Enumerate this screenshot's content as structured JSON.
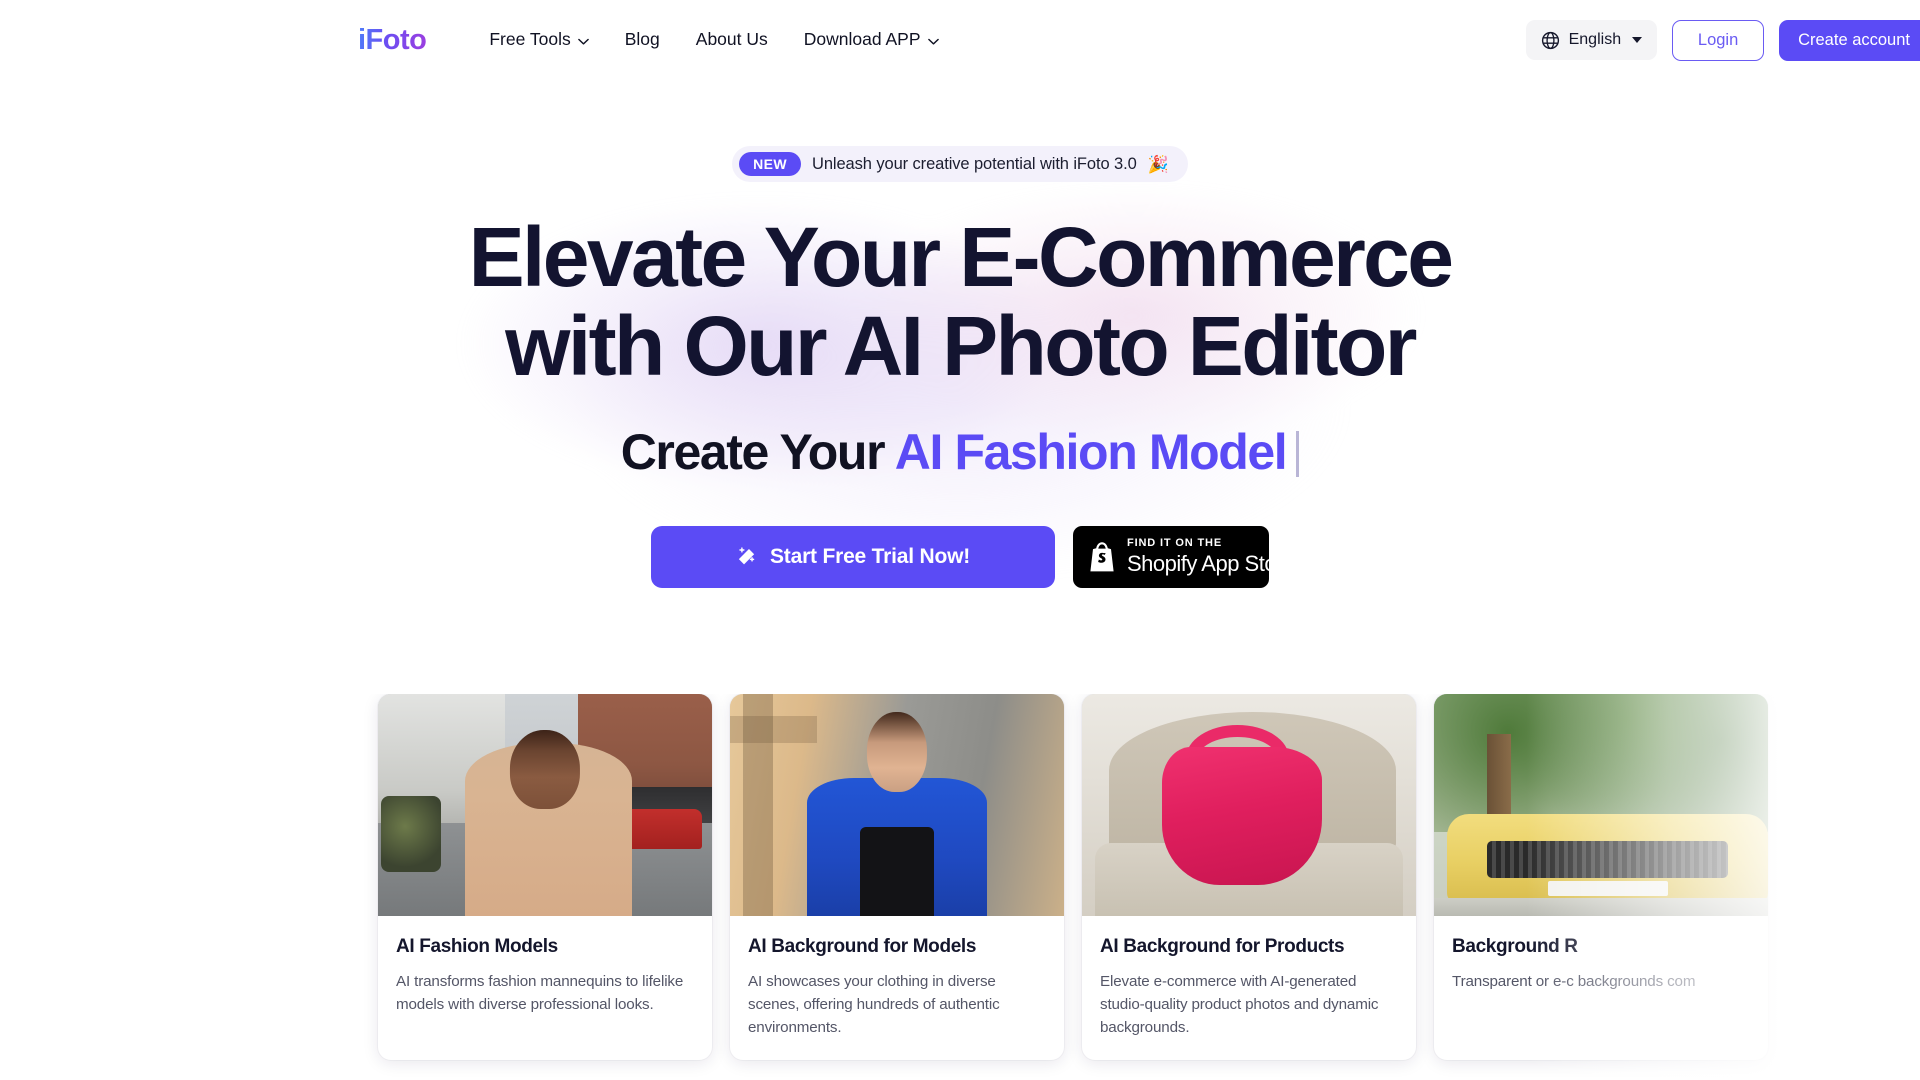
{
  "brand": {
    "name": "iFoto"
  },
  "nav": {
    "items": [
      {
        "label": "Free Tools",
        "has_dropdown": true
      },
      {
        "label": "Blog",
        "has_dropdown": false
      },
      {
        "label": "About Us",
        "has_dropdown": false
      },
      {
        "label": "Download APP",
        "has_dropdown": true
      }
    ]
  },
  "header_actions": {
    "language": {
      "label": "English",
      "icon": "globe-icon"
    },
    "login_label": "Login",
    "create_account_label": "Create account"
  },
  "hero": {
    "announcement": {
      "badge": "NEW",
      "text": "Unleash your creative potential with iFoto 3.0",
      "emoji": "🎉"
    },
    "headline_line1": "Elevate Your E-Commerce",
    "headline_line2": "with Our AI Photo Editor",
    "subhead_static": "Create Your ",
    "subhead_accent": "AI Fashion Model",
    "cta_primary": {
      "label": "Start Free Trial Now!",
      "icon": "magic-wand-icon"
    },
    "cta_shopify": {
      "small": "FIND IT ON THE",
      "big": "Shopify App Store",
      "icon": "shopify-bag-icon"
    }
  },
  "cards": [
    {
      "title": "AI Fashion Models",
      "description": "AI transforms fashion mannequins to lifelike models with diverse professional looks.",
      "image_alt": "smiling man in beige t-shirt on a town street"
    },
    {
      "title": "AI Background for Models",
      "description": "AI showcases your clothing in diverse scenes, offering hundreds of authentic environments.",
      "image_alt": "smiling woman in blue jacket against a sunlit wall"
    },
    {
      "title": "AI Background for Products",
      "description": "Elevate e-commerce with AI-generated studio-quality product photos and dynamic backgrounds.",
      "image_alt": "pink pleated handbag on a beige armchair"
    },
    {
      "title": "Background R",
      "description": "Transparent or e-c backgrounds com",
      "image_alt": "yellow sports car in front of green trees"
    }
  ],
  "colors": {
    "brand_purple": "#5b4bf5",
    "headline_navy": "#131430",
    "badge_bg": "#f3f1fb",
    "body_text": "#545667",
    "shopify_black": "#000000"
  }
}
